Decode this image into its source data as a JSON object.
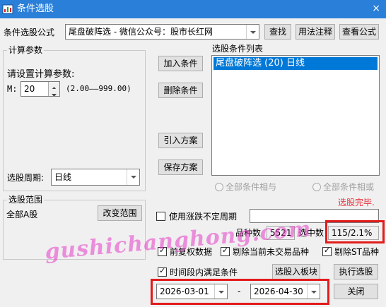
{
  "window": {
    "title": "条件选股",
    "close_glyph": "×"
  },
  "formula": {
    "label": "条件选股公式",
    "value": "尾盘破阵选  -  微信公众号：股市长红网",
    "find_label": "查找",
    "usage_label": "用法注释",
    "view_label": "查看公式"
  },
  "calc": {
    "legend": "计算参数",
    "prompt": "请设置计算参数:",
    "param_name": "M:",
    "param_value": "20",
    "param_range": "(2.00——999.00)"
  },
  "period": {
    "label": "选股周期:",
    "value": "日线"
  },
  "actions": {
    "add_label": "加入条件",
    "delete_label": "删除条件",
    "import_label": "引入方案",
    "save_label": "保存方案"
  },
  "conditions": {
    "legend": "选股条件列表",
    "items": [
      "尾盘破阵选 (20) 日线"
    ]
  },
  "logic": {
    "and_label": "全部条件相与",
    "or_label": "全部条件相或"
  },
  "status": {
    "done_text": "选股完毕.",
    "done_color": "#e8323c"
  },
  "scope": {
    "legend": "选股范围",
    "value": "全部A股",
    "change_label": "改变范围"
  },
  "uncertain": {
    "label": "使用涨跌不定周期",
    "checked": false
  },
  "counts": {
    "total_label": "品种数",
    "total_value": "5521",
    "selected_label": "选中数",
    "selected_value": "115/2.1%"
  },
  "options": {
    "adjust_label": "前复权数据",
    "exclude_untraded_label": "剔除当前未交易品种",
    "exclude_st_label": "剔除ST品种"
  },
  "range": {
    "label": "时间段内满足条件",
    "checked": true,
    "start_date": "2026-03-01",
    "separator": "-",
    "end_date": "2026-04-30"
  },
  "buttons": {
    "to_block_label": "选股入板块",
    "execute_label": "执行选股",
    "close_label": "关闭"
  },
  "watermark": "gushichanghong.com",
  "colors": {
    "titlebar": "#2a7fd8",
    "selection": "#0078d7",
    "highlight_box": "#e21b1b"
  }
}
